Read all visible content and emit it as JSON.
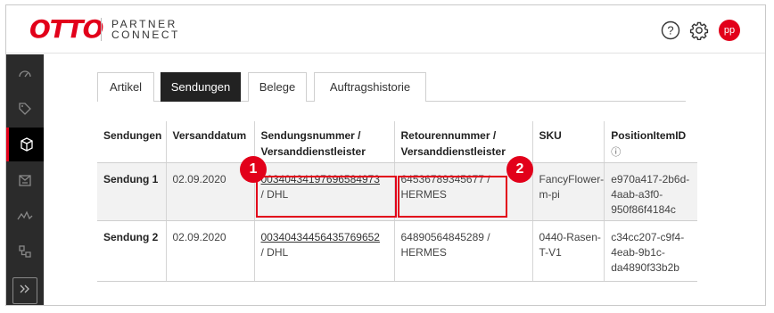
{
  "brand": {
    "logo": "OTTO",
    "product_line1": "PARTNER",
    "product_line2": "CONNECT"
  },
  "header": {
    "help_icon": "help-circle-icon",
    "settings_icon": "gear-icon",
    "avatar_initials": "pp",
    "accent_color": "#e2001a"
  },
  "sidebar": {
    "items": [
      {
        "icon": "gauge-icon",
        "active": false
      },
      {
        "icon": "tag-icon",
        "active": false
      },
      {
        "icon": "package-icon",
        "active": true
      },
      {
        "icon": "return-package-icon",
        "active": false
      },
      {
        "icon": "analytics-icon",
        "active": false
      },
      {
        "icon": "network-icon",
        "active": false
      }
    ],
    "bottom_icon": "expand-sidebar-icon"
  },
  "tabs": [
    {
      "label": "Artikel",
      "active": false
    },
    {
      "label": "Sendungen",
      "active": true
    },
    {
      "label": "Belege",
      "active": false
    },
    {
      "label": "Auftragshistorie",
      "active": false
    }
  ],
  "table": {
    "headers": [
      "Sendungen",
      "Versanddatum",
      "Sendungsnummer / Versanddienstleister",
      "Retourennummer / Versanddienstleister",
      "SKU",
      "PositionItemID"
    ],
    "info_icon": "ⓘ",
    "rows": [
      {
        "sendung": "Sendung 1",
        "datum": "02.09.2020",
        "sendungsnummer": "00340434197696584973",
        "sendung_dienstleister": "/ DHL",
        "retourennummer": "64536789345677 /",
        "retoure_dienstleister": "HERMES",
        "sku_line1": "FancyFlower-",
        "sku_line2": "m-pi",
        "item_line1": "e970a417-2b6d-",
        "item_line2": "4aab-a3f0-",
        "item_line3": "950f86f4184c"
      },
      {
        "sendung": "Sendung 2",
        "datum": "02.09.2020",
        "sendungsnummer": "00340434456435769652",
        "sendung_dienstleister": "/ DHL",
        "retourennummer": "64890564845289 /",
        "retoure_dienstleister": "HERMES",
        "sku_line1": "0440-Rasen-",
        "sku_line2": "T-V1",
        "item_line1": "c34cc207-c9f4-",
        "item_line2": "4eab-9b1c-",
        "item_line3": "da4890f33b2b"
      }
    ]
  },
  "annotations": [
    {
      "number": "1"
    },
    {
      "number": "2"
    }
  ]
}
